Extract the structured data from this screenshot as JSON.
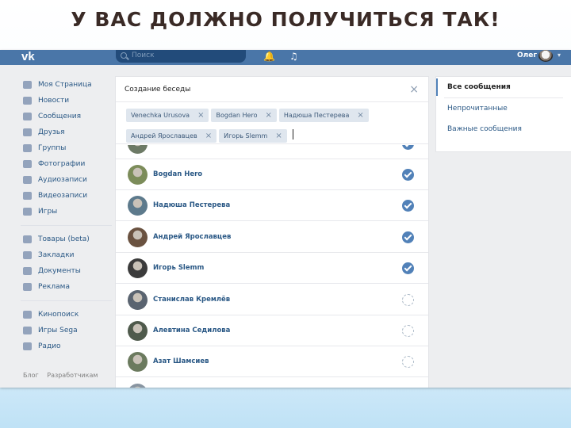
{
  "slide_title": "У ВАС ДОЛЖНО ПОЛУЧИТЬСЯ ТАК!",
  "header": {
    "logo": "vk",
    "search_placeholder": "Поиск",
    "bell_icon": "🔔",
    "music_icon": "♫",
    "user_name": "Олег",
    "caret": "▾"
  },
  "sidebar": {
    "items": [
      {
        "label": "Моя Страница",
        "icon": "home-icon"
      },
      {
        "label": "Новости",
        "icon": "news-icon"
      },
      {
        "label": "Сообщения",
        "icon": "messages-icon"
      },
      {
        "label": "Друзья",
        "icon": "friends-icon"
      },
      {
        "label": "Группы",
        "icon": "groups-icon"
      },
      {
        "label": "Фотографии",
        "icon": "camera-icon"
      },
      {
        "label": "Аудиозаписи",
        "icon": "music-icon"
      },
      {
        "label": "Видеозаписи",
        "icon": "video-icon"
      },
      {
        "label": "Игры",
        "icon": "gamepad-icon"
      }
    ],
    "items2": [
      {
        "label": "Товары (beta)",
        "icon": "shop-icon"
      },
      {
        "label": "Закладки",
        "icon": "star-icon"
      },
      {
        "label": "Документы",
        "icon": "document-icon"
      },
      {
        "label": "Реклама",
        "icon": "ads-icon"
      }
    ],
    "items3": [
      {
        "label": "Кинопоиск",
        "icon": "app-grid-icon"
      },
      {
        "label": "Игры Sega",
        "icon": "app-grid-icon"
      },
      {
        "label": "Радио",
        "icon": "app-grid-icon"
      }
    ],
    "footer": [
      "Блог",
      "Разработчикам"
    ]
  },
  "conversation": {
    "title": "Создание беседы",
    "close": "×",
    "chip_close": "×",
    "chips": [
      "Venechka Urusova",
      "Bogdan Hero",
      "Надюша Пестерева",
      "Андрей Ярославцев",
      "Игорь Slemm"
    ],
    "members": [
      {
        "name": "",
        "checked": true,
        "color": "#6d7a66"
      },
      {
        "name": "Bogdan Hero",
        "checked": true,
        "color": "#7c8c5a"
      },
      {
        "name": "Надюша Пестерева",
        "checked": true,
        "color": "#5d7a8c"
      },
      {
        "name": "Андрей Ярославцев",
        "checked": true,
        "color": "#6a5240"
      },
      {
        "name": "Игорь Slemm",
        "checked": true,
        "color": "#3b3b3b"
      },
      {
        "name": "Станислав Кремлёв",
        "checked": false,
        "color": "#5a6470"
      },
      {
        "name": "Алевтина Седилова",
        "checked": false,
        "color": "#4f5a4c"
      },
      {
        "name": "Азат Шамсиев",
        "checked": false,
        "color": "#6b7a5e"
      },
      {
        "name": "",
        "checked": false,
        "color": "#8894a0"
      }
    ]
  },
  "right_menu": {
    "items": [
      "Все сообщения",
      "Непрочитанные",
      "Важные сообщения"
    ]
  },
  "colors": {
    "header": "#4a76a8",
    "link": "#2a5885",
    "check": "#5181b8"
  }
}
